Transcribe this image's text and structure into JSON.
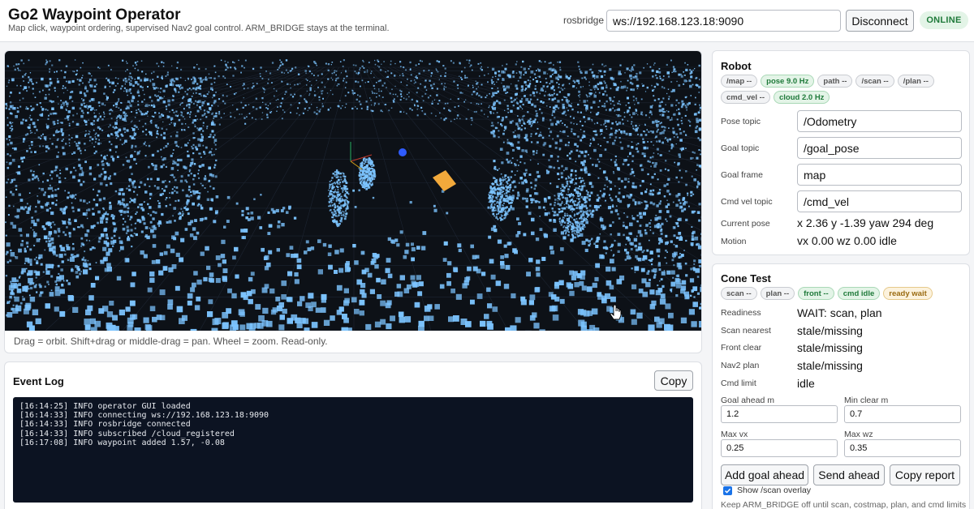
{
  "header": {
    "title": "Go2 Waypoint Operator",
    "subtitle": "Map click, waypoint ordering, supervised Nav2 goal control. ARM_BRIDGE stays at the terminal.",
    "rosbridge_label": "rosbridge",
    "rosbridge_url": "ws://192.168.123.18:9090",
    "disconnect_label": "Disconnect",
    "status": "ONLINE"
  },
  "viewer": {
    "hint": "Drag = orbit. Shift+drag or middle-drag = pan. Wheel = zoom. Read-only."
  },
  "event_log": {
    "title": "Event Log",
    "copy_label": "Copy",
    "lines": [
      "[16:14:25] INFO operator GUI loaded",
      "[16:14:33] INFO connecting ws://192.168.123.18:9090",
      "[16:14:33] INFO rosbridge connected",
      "[16:14:33] INFO subscribed /cloud_registered",
      "[16:17:08] INFO waypoint added 1.57, -0.08"
    ]
  },
  "robot": {
    "title": "Robot",
    "badges": [
      {
        "label": "/map --",
        "state": "neutral"
      },
      {
        "label": "pose 9.0 Hz",
        "state": "ok"
      },
      {
        "label": "path --",
        "state": "neutral"
      },
      {
        "label": "/scan --",
        "state": "neutral"
      },
      {
        "label": "/plan --",
        "state": "neutral"
      },
      {
        "label": "cmd_vel --",
        "state": "neutral"
      },
      {
        "label": "cloud 2.0 Hz",
        "state": "ok"
      }
    ],
    "pose_topic_label": "Pose topic",
    "pose_topic": "/Odometry",
    "goal_topic_label": "Goal topic",
    "goal_topic": "/goal_pose",
    "goal_frame_label": "Goal frame",
    "goal_frame": "map",
    "cmd_vel_topic_label": "Cmd vel topic",
    "cmd_vel_topic": "/cmd_vel",
    "current_pose_label": "Current pose",
    "current_pose": "x 2.36 y -1.39 yaw 294 deg",
    "motion_label": "Motion",
    "motion": "vx 0.00 wz 0.00 idle"
  },
  "cone_test": {
    "title": "Cone Test",
    "badges": [
      {
        "label": "scan --",
        "state": "neutral"
      },
      {
        "label": "plan --",
        "state": "neutral"
      },
      {
        "label": "front --",
        "state": "ok"
      },
      {
        "label": "cmd idle",
        "state": "ok"
      },
      {
        "label": "ready wait",
        "state": "warn"
      }
    ],
    "readiness_label": "Readiness",
    "readiness": "WAIT: scan, plan",
    "scan_nearest_label": "Scan nearest",
    "scan_nearest": "stale/missing",
    "front_clear_label": "Front clear",
    "front_clear": "stale/missing",
    "nav2_plan_label": "Nav2 plan",
    "nav2_plan": "stale/missing",
    "cmd_limit_label": "Cmd limit",
    "cmd_limit": "idle",
    "goal_ahead_label": "Goal ahead m",
    "goal_ahead": "1.2",
    "min_clear_label": "Min clear m",
    "min_clear": "0.7",
    "max_vx_label": "Max vx",
    "max_vx": "0.25",
    "max_wz_label": "Max wz",
    "max_wz": "0.35",
    "add_goal_label": "Add goal ahead",
    "send_ahead_label": "Send ahead",
    "copy_report_label": "Copy report",
    "show_scan_label": "Show /scan overlay",
    "show_scan_checked": true,
    "note": "Keep ARM_BRIDGE off until scan, costmap, plan, and cmd limits"
  },
  "colors": {
    "points": "#7cc4ff",
    "robot_dot": "#2f5cff",
    "waypoint": "#f2a93b",
    "ok": "#1f7a3a",
    "warn": "#9a6a10"
  }
}
